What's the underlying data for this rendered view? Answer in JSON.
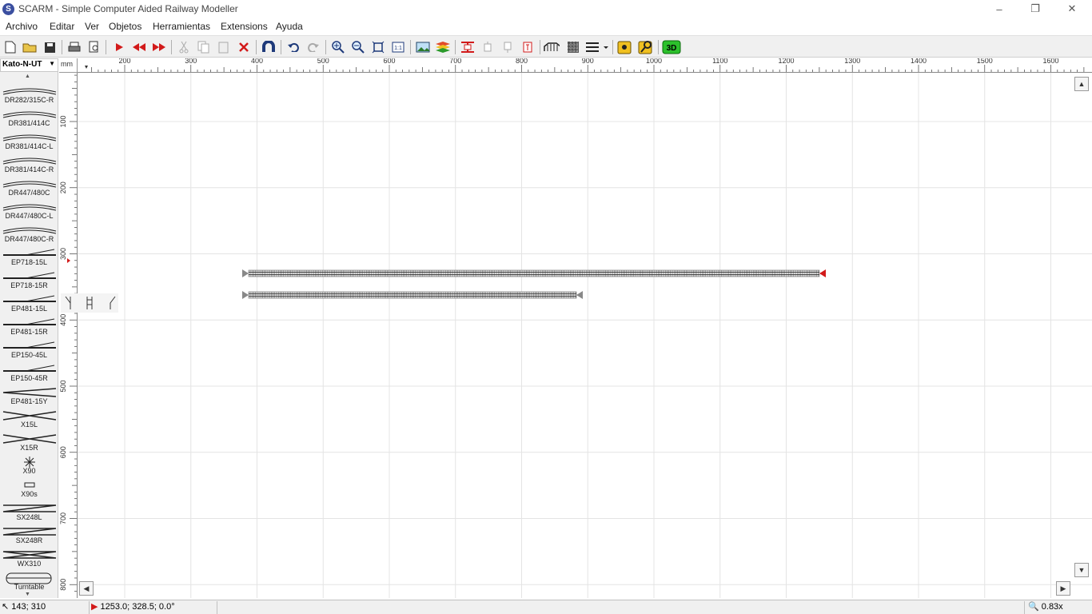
{
  "window": {
    "title": "SCARM - Simple Computer Aided Railway Modeller",
    "app_icon_letter": "S",
    "minimize": "–",
    "restore": "❐",
    "close": "✕"
  },
  "menu": [
    "Archivo",
    "Editar",
    "Ver",
    "Objetos",
    "Herramientas",
    "Extensions",
    "Ayuda"
  ],
  "toolbar": {
    "buttons": [
      "new-file-icon",
      "open-folder-icon",
      "save-icon",
      "print-icon",
      "print-preview-icon",
      "run-icon",
      "go-start-icon",
      "go-end-icon",
      "cut-icon",
      "copy-icon",
      "paste-icon",
      "delete-icon",
      "magnet-icon",
      "undo-icon",
      "redo-icon",
      "zoom-in-icon",
      "zoom-out-icon",
      "zoom-fit-icon",
      "zoom-1to1-icon",
      "background-image-icon",
      "layers-icon",
      "track-connect-icon",
      "ruler-object-icon",
      "ruler-object-2-icon",
      "text-object-icon",
      "bridge-icon",
      "grid-icon",
      "lines-menu-icon",
      "measure-icon",
      "measure-2-icon",
      "3d-view-icon"
    ],
    "label_1to1": "1:1",
    "label_3d": "3D"
  },
  "library": {
    "selected": "Kato-N-UT",
    "items": [
      "DR282/315C-R",
      "DR381/414C",
      "DR381/414C-L",
      "DR381/414C-R",
      "DR447/480C",
      "DR447/480C-L",
      "DR447/480C-R",
      "EP718-15L",
      "EP718-15R",
      "EP481-15L",
      "EP481-15R",
      "EP150-45L",
      "EP150-45R",
      "EP481-15Y",
      "X15L",
      "X15R",
      "X90",
      "X90s",
      "SX248L",
      "SX248R",
      "WX310",
      "Turntable"
    ]
  },
  "rulers": {
    "unit": "mm",
    "h_labels": [
      "200",
      "300",
      "400",
      "500",
      "600",
      "700",
      "800",
      "900",
      "1000",
      "1100",
      "1200",
      "1300",
      "1400",
      "1500",
      "1600"
    ],
    "v_labels": [
      "100",
      "200",
      "300",
      "400",
      "500",
      "600",
      "700",
      "800"
    ]
  },
  "status": {
    "cursor": "143; 310",
    "track_pos": "1253.0; 328.5; 0.0°",
    "zoom": "0.83x"
  }
}
